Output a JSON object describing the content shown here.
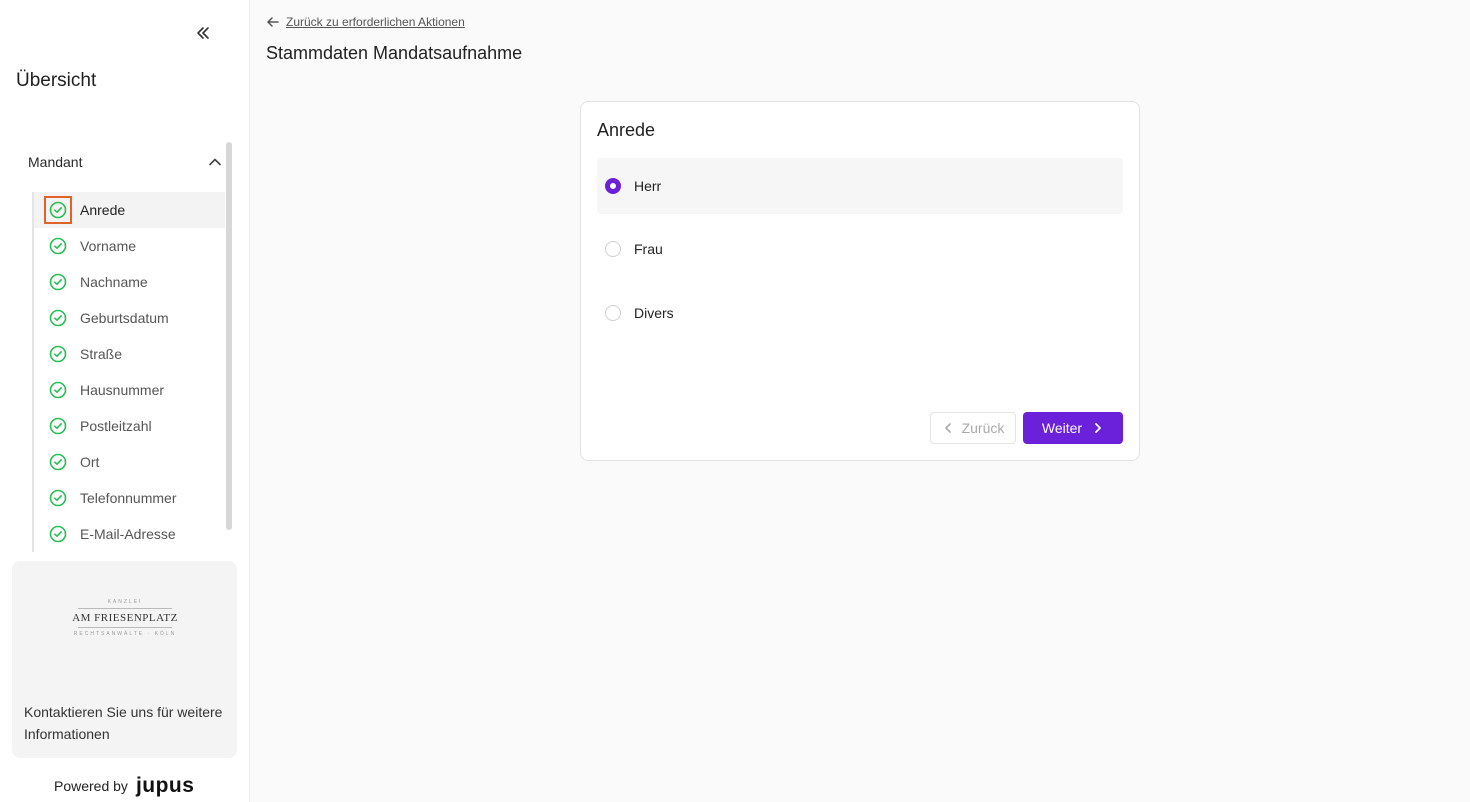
{
  "sidebar": {
    "overview_title": "Übersicht",
    "section_label": "Mandant",
    "items": [
      {
        "label": "Anrede",
        "active": true
      },
      {
        "label": "Vorname"
      },
      {
        "label": "Nachname"
      },
      {
        "label": "Geburtsdatum"
      },
      {
        "label": "Straße"
      },
      {
        "label": "Hausnummer"
      },
      {
        "label": "Postleitzahl"
      },
      {
        "label": "Ort"
      },
      {
        "label": "Telefonnummer"
      },
      {
        "label": "E-Mail-Adresse"
      }
    ],
    "contact": {
      "logo_top": "KANZLEI",
      "logo_name": "AM FRIESENPLATZ",
      "logo_bottom": "RECHTSANWÄLTE · KÖLN",
      "text": "Kontaktieren Sie uns für weitere Informationen"
    },
    "powered_by": "Powered by",
    "brand": "jupus"
  },
  "main": {
    "back_link": "Zurück zu erforderlichen Aktionen",
    "page_title": "Stammdaten Mandatsaufnahme",
    "card": {
      "title": "Anrede",
      "options": [
        {
          "label": "Herr",
          "selected": true
        },
        {
          "label": "Frau"
        },
        {
          "label": "Divers"
        }
      ],
      "back_label": "Zurück",
      "next_label": "Weiter"
    }
  },
  "colors": {
    "accent": "#6a21d9",
    "check_green": "#2bbd55",
    "focus_outline": "#e0632a"
  },
  "icons": {
    "collapse": "double-chevron-left-icon",
    "section_toggle": "chevron-up-icon",
    "item_status": "check-circle-icon",
    "back": "arrow-left-icon",
    "prev": "chevron-left-icon",
    "next": "chevron-right-icon"
  }
}
